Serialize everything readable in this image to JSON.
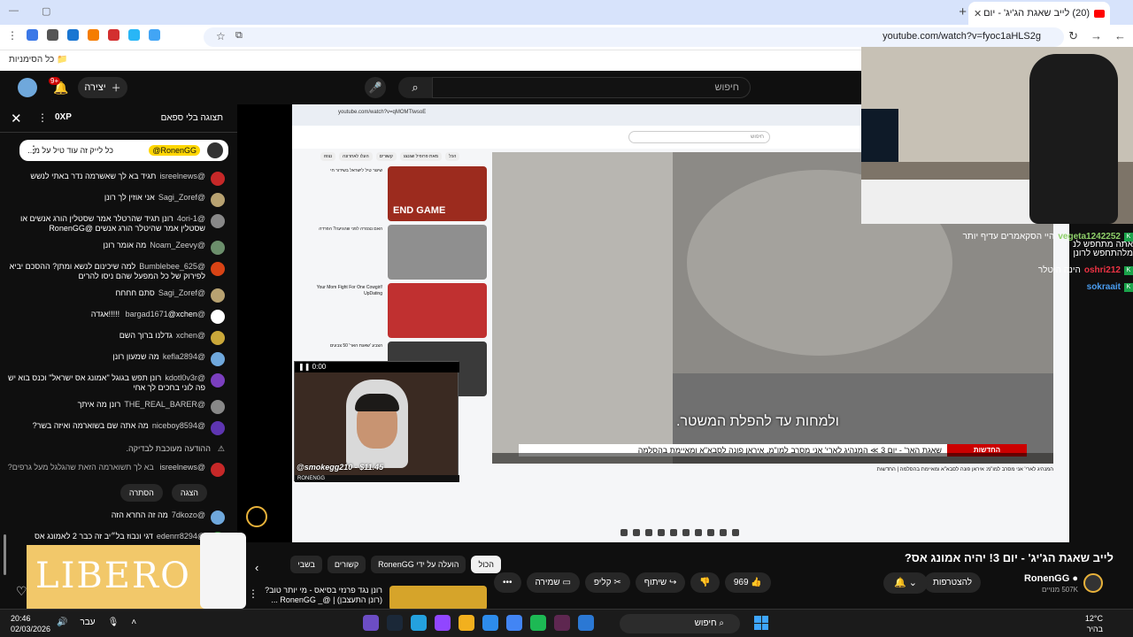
{
  "browser": {
    "tab_title": "(20) לייב שאגת הג'יג' - יום",
    "tab_close": "✕",
    "new_tab": "+",
    "url": "youtube.com/watch?v=fyoc1aHLS2g",
    "bookmarks_label": "כל הסימניות"
  },
  "youtube": {
    "search_placeholder": "חיפוש",
    "create_label": "יצירה",
    "notif_count": "9+"
  },
  "chat": {
    "header_title": "תצוגה בלי ספאם",
    "xp": "0XP",
    "pinned": {
      "name": "@RonenGG",
      "text": "כל לייק זה עוד טיל על מ..."
    },
    "messages": [
      {
        "name": "@isreelnews",
        "text": "תגיד בא לך שאשרמה נדר באתי לנשש",
        "color": "#c62828"
      },
      {
        "name": "@Sagi_Zoref",
        "text": "אני אוזין לך רונן",
        "color": "#b8a271"
      },
      {
        "name": "@4ori-1",
        "text": "רונן תגיד שהרטלר אמר שסטלין הורג אנשים או שסטלין אמר שהיטלר הורג אנשים @RonenGG",
        "color": "#888"
      },
      {
        "name": "@Noam_Zeevy",
        "text": "מה אומר רונן",
        "color": "#6b8e6b"
      },
      {
        "name": "@Bumblebee_625",
        "text": "למה שיכינום לנשא ומתן? ההסכם יביא לפירוק של כל המפעל שהם ניסו להרים",
        "color": "#d84315"
      },
      {
        "name": "@Sagi_Zoref",
        "text": "סתם חחחח",
        "color": "#b8a271"
      },
      {
        "name": "@bargad1671",
        "text": "@xchen !!!!!אגדה",
        "color": "#fff"
      },
      {
        "name": "@xchen",
        "text": "גדלנו ברוך השם",
        "color": "#caa83a"
      },
      {
        "name": "@kefla2894",
        "text": "מה שמעון רונן",
        "color": "#6fa8dc"
      },
      {
        "name": "@kdotl0v3r",
        "text": "רונן תפש בגוגל \"אמונג אס ישראל\" וכנס בוא יש פה לוני בחכים לך אחי",
        "color": "#7b3fbf"
      },
      {
        "name": "@THE_REAL_BARER",
        "text": "רונן מה איתך",
        "color": "#888"
      },
      {
        "name": "@niceboy8594",
        "text": "מה אתה שם בשוארמה ואיזה בשר?",
        "color": "#5e35b1"
      }
    ],
    "system_notice": "ההודעה מעוכבת לבדיקה.",
    "held": {
      "name": "@isreelnews",
      "text": "בא לך תשוארמה הזאת שהגלגל מעל גרפים?"
    },
    "show_label": "הצגה",
    "hide_label": "הסתרה",
    "messages2": [
      {
        "name": "@7dkozo",
        "text": "מה זה החרא הזה",
        "color": "#6fa8dc"
      },
      {
        "name": "@edenrr8294",
        "text": "דגי ונבוז בל״יב זה כבר 2 לאמונג אס",
        "color": "#2e7d32"
      },
      {
        "name": "@7dkozo",
        "text": "תחליף",
        "color": "#6fa8dc"
      }
    ]
  },
  "inner_video": {
    "url": "youtube.com/watch?v=qMOMTlwsoE",
    "search": "חיפוש",
    "chips": [
      "הכל",
      "מאת פרופיל שגנצג",
      "קשורים",
      "העלו לאחרונה",
      "נצפו"
    ],
    "recs": [
      {
        "title": "שיגור טיל לישראל בשידור חי",
        "thumb_color": "#9c2b1e",
        "thumb_text": "END GAME"
      },
      {
        "title": "האם נצנזרה לפני שהגיעה? הפרדה",
        "thumb_color": "#8f8f8f",
        "thumb_text": ""
      },
      {
        "title": "Your Mom Fight For One Cowgirl! UpDating",
        "thumb_color": "#c03030",
        "thumb_text": ""
      },
      {
        "title": "הצבע 'שאגת האר' 50 צבעים",
        "thumb_color": "#3a3a3a",
        "thumb_text": ""
      }
    ],
    "subtitle": "ולמחות עד להפלת המשטר.",
    "news_label": "החדשות",
    "ticker": "שאגת האר' - יום 3 ≫ המנהיג לארי' אני מסרב למו\"מ, איראן פונה לסבא\"א ומאיימת בהסלמה",
    "video_title": "המנהיג לארי' אני מסרב למו\"מ: איראן פונה לסבא\"א ומאיימת בהסלמה | החדשות"
  },
  "cam": {
    "superchat": "@smokegg210 - $11.45",
    "time": "0:00",
    "brand": "RONENGG"
  },
  "overlay": [
    {
      "name": "vegeta1242252",
      "text": "היי הסקאמרים עדיף יותר",
      "style": "green"
    },
    {
      "name": "",
      "text": "מלהתחפש לרונן",
      "style": "plain"
    },
    {
      "name": "oshri212",
      "text": "הינה היטלר",
      "style": "red"
    },
    {
      "name": "sokraait",
      "text": "",
      "style": "blue"
    }
  ],
  "right_caption": "אתה מתחפש לנ",
  "below": {
    "chips": [
      "הכול",
      "הועלה על ידי RonenGG",
      "קשורים",
      "בשבי"
    ],
    "suggest": "רונן נגד פרנזי בסיאס - מי יותר טוב? (רונן התעצבן) | @_ RonenGG ...",
    "title": "לייב שאגת הג'יג' - יום 3! יהיה אמונג אס?",
    "channel": "RonenGG",
    "subs": "507K מנויים",
    "subscribe": "להצטרפות",
    "likes": "969",
    "share": "שיתוף",
    "clip": "קליפ",
    "save": "שמירה",
    "more": "•••"
  },
  "ad": {
    "brand": "LIBERO"
  },
  "taskbar": {
    "time": "20:46",
    "date": "02/03/2026",
    "lang": "עבר",
    "search": "חיפוש",
    "temp": "12°C",
    "weather": "בהיר"
  },
  "colors": {
    "accent": "#ff0000",
    "brand_gold": "#e8b23a"
  }
}
